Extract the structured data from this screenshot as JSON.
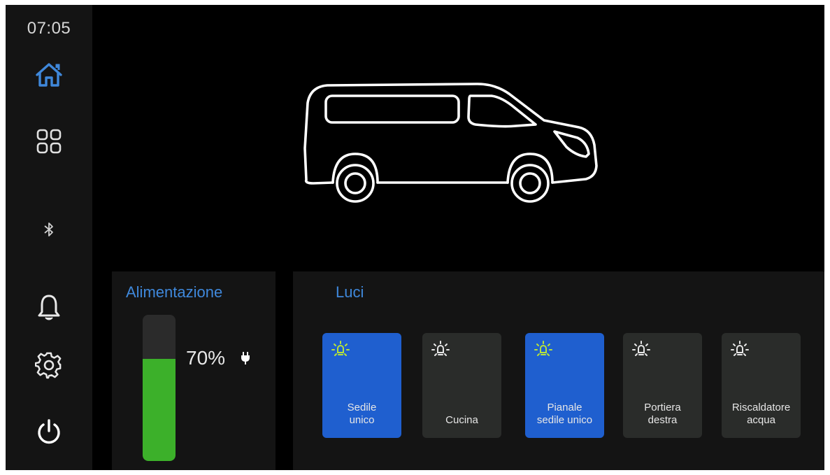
{
  "status": {
    "time": "07:05"
  },
  "sidebar": {
    "items": [
      {
        "name": "home",
        "icon": "home-icon",
        "active": true
      },
      {
        "name": "apps",
        "icon": "apps-grid-icon",
        "active": false
      },
      {
        "name": "bluetooth",
        "icon": "bluetooth-icon",
        "active": false
      },
      {
        "name": "notifications",
        "icon": "bell-icon",
        "active": false
      },
      {
        "name": "settings",
        "icon": "gear-icon",
        "active": false
      },
      {
        "name": "power",
        "icon": "power-icon",
        "active": false
      }
    ]
  },
  "vehicle": {
    "icon": "van-outline"
  },
  "power": {
    "title": "Alimentazione",
    "battery_percent": 70,
    "battery_label": "70%",
    "charging_icon": "plug-icon"
  },
  "lights": {
    "title": "Luci",
    "items": [
      {
        "line1": "Sedile",
        "line2": "unico",
        "on": true
      },
      {
        "line1": "Cucina",
        "line2": "",
        "on": false
      },
      {
        "line1": "Pianale",
        "line2": "sedile unico",
        "on": true
      },
      {
        "line1": "Portiera",
        "line2": "destra",
        "on": false
      },
      {
        "line1": "Riscaldatore",
        "line2": "acqua",
        "on": false
      }
    ]
  },
  "colors": {
    "accent_blue": "#3f88db",
    "tile_on": "#1f5fcf",
    "tile_off": "#2a2c2a",
    "battery_green": "#3cb02a",
    "bulb_on": "#b6e33a",
    "panel_bg": "#141414"
  }
}
